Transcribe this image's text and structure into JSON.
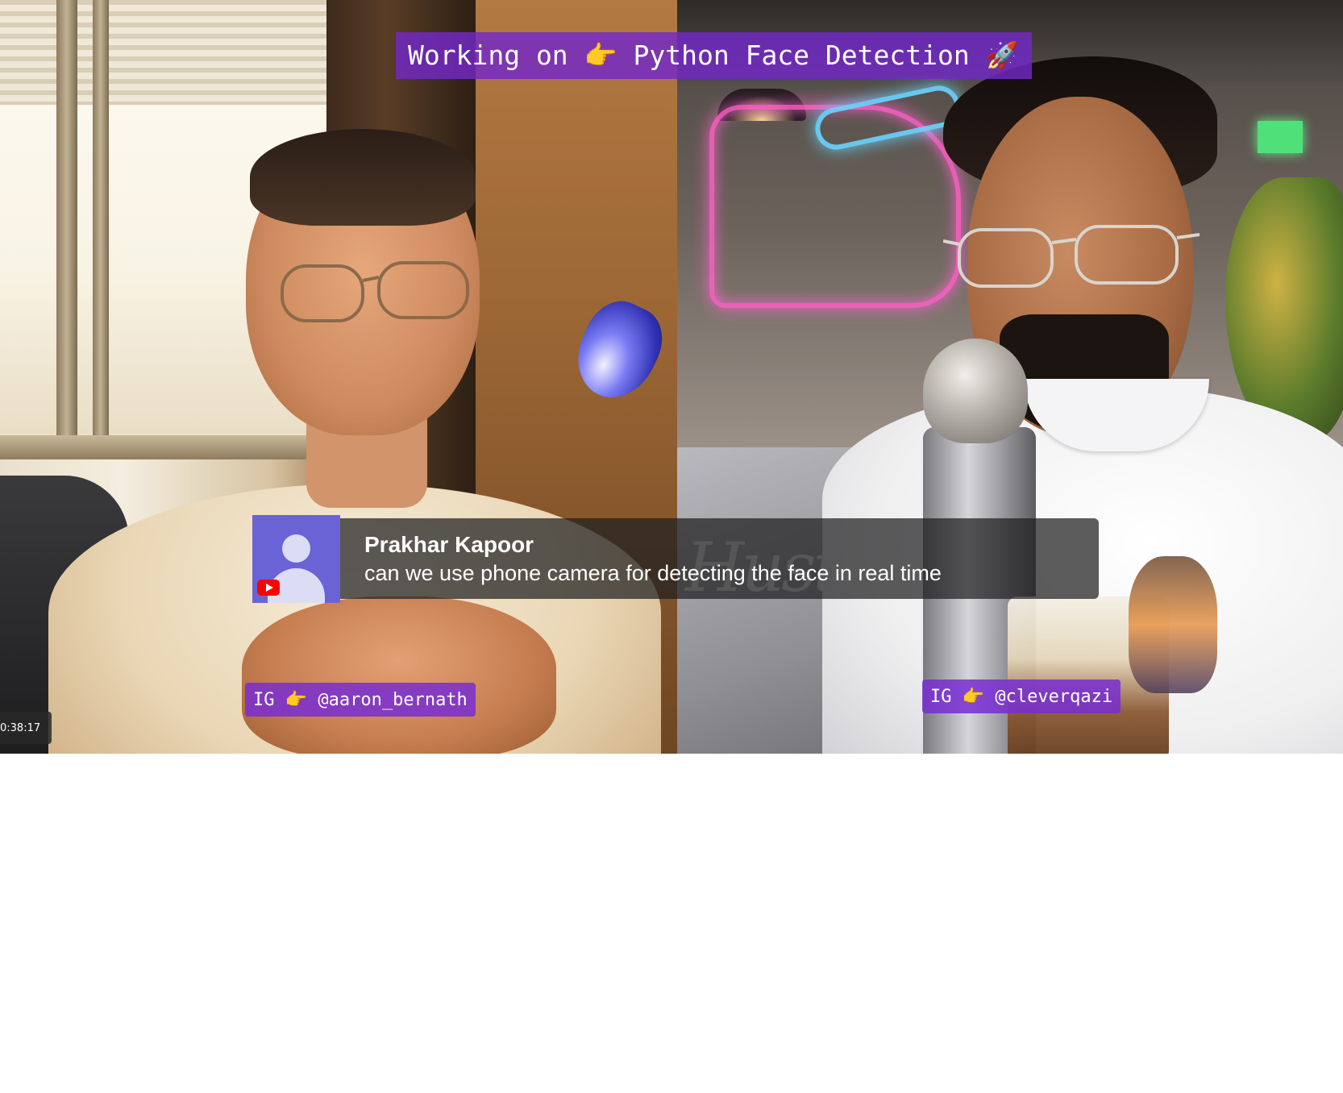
{
  "stream": {
    "title_banner": "Working on 👉 Python Face Detection 🚀",
    "timestamp": "0:38:17"
  },
  "chat_highlight": {
    "author": "Prakhar Kapoor",
    "message": "can we use phone camera for detecting the face in real time",
    "avatar_icon": "default-user-icon",
    "platform_icon": "youtube-icon",
    "platform_color": "#ff0000",
    "avatar_color": "#6a63d6"
  },
  "participants": [
    {
      "handle_label": "IG 👉 @aaron_bernath"
    },
    {
      "handle_label": "IG 👉 @cleverqazi"
    }
  ],
  "theme": {
    "accent": "#7328c8"
  }
}
